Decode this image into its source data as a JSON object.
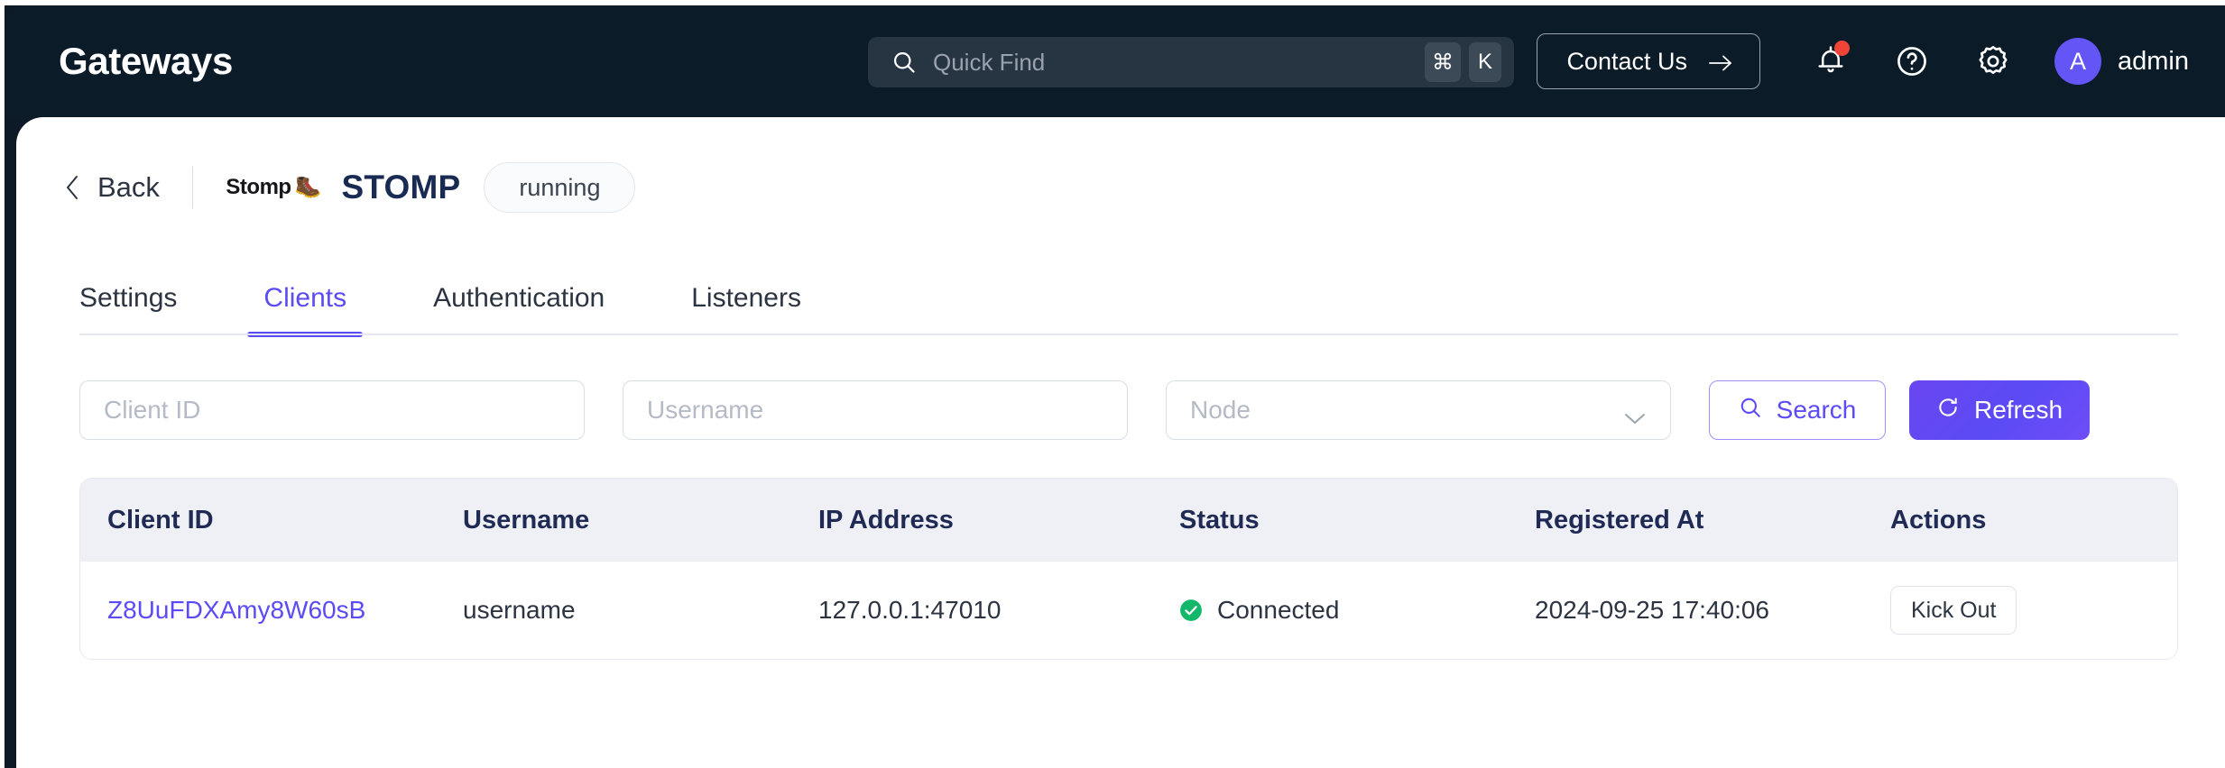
{
  "navbar": {
    "brand": "Gateways",
    "search": {
      "placeholder": "Quick Find",
      "kbd_mod": "⌘",
      "kbd_key": "K"
    },
    "contact_label": "Contact Us",
    "user": {
      "initial": "A",
      "name": "admin"
    },
    "colors": {
      "background": "#0c1b28",
      "search_field": "#273543",
      "kbd_badge": "#3c4a58",
      "notification_dot": "#f04438",
      "avatar": "#6355f6"
    }
  },
  "page": {
    "back_label": "Back",
    "service_logo_text": "Stomp",
    "service_logo_glyph": "🥾",
    "service_title": "STOMP",
    "status_pill": "running"
  },
  "tabs": [
    {
      "label": "Settings",
      "active": false
    },
    {
      "label": "Clients",
      "active": true
    },
    {
      "label": "Authentication",
      "active": false
    },
    {
      "label": "Listeners",
      "active": false
    }
  ],
  "filters": {
    "client_id_placeholder": "Client ID",
    "username_placeholder": "Username",
    "node_placeholder": "Node",
    "search_label": "Search",
    "refresh_label": "Refresh",
    "accent": "#5b4bf5"
  },
  "table": {
    "columns": [
      "Client ID",
      "Username",
      "IP Address",
      "Status",
      "Registered At",
      "Actions"
    ],
    "rows": [
      {
        "client_id": "Z8UuFDXAmy8W60sB",
        "username": "username",
        "ip_address": "127.0.0.1:47010",
        "status": "Connected",
        "status_color": "#12b76a",
        "registered_at": "2024-09-25 17:40:06",
        "action_label": "Kick Out"
      }
    ]
  }
}
